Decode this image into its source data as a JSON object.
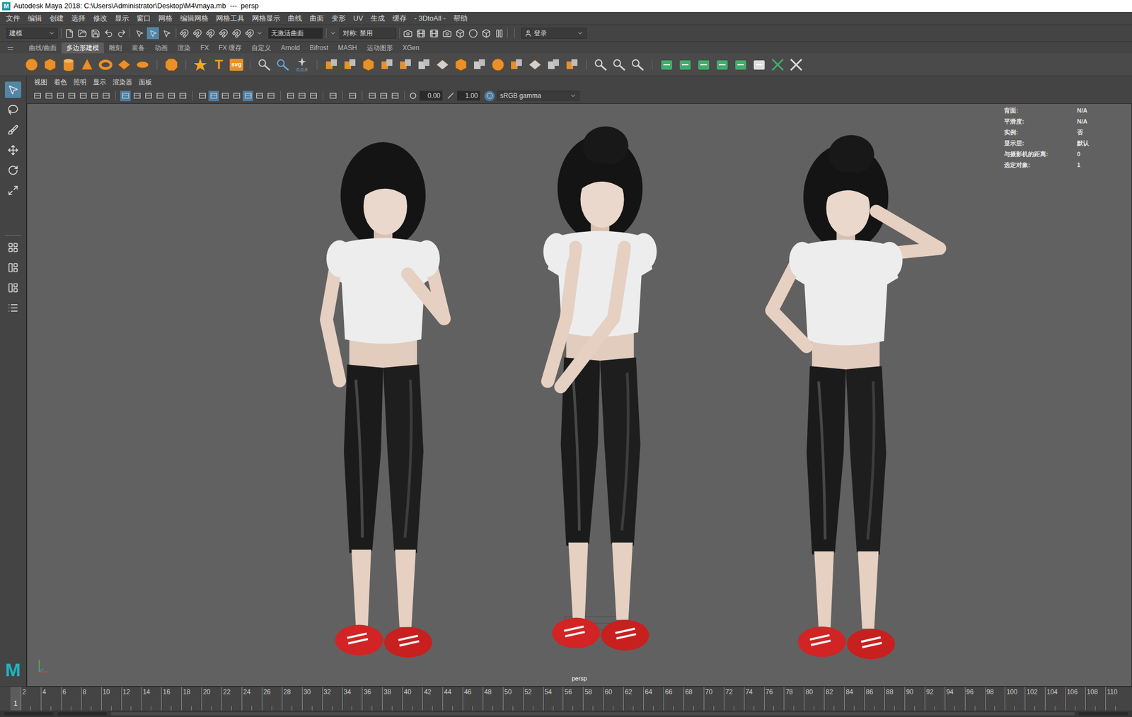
{
  "window": {
    "title": "Autodesk Maya 2018: C:\\Users\\Administrator\\Desktop\\M4\\maya.mb  ---  persp",
    "logo": "M"
  },
  "menu": [
    "文件",
    "编辑",
    "创建",
    "选择",
    "修改",
    "显示",
    "窗口",
    "网格",
    "编辑网格",
    "网格工具",
    "网格显示",
    "曲线",
    "曲面",
    "变形",
    "UV",
    "生成",
    "缓存",
    "- 3DtoAll -",
    "帮助"
  ],
  "status_line": {
    "mode": "建模",
    "surface": "无激活曲面",
    "symmetry": "对称: 禁用",
    "login": "登录",
    "toggles": [
      {
        "on": false
      },
      {
        "on": true
      },
      {
        "on": false
      }
    ]
  },
  "shelf": {
    "tabs": [
      {
        "label": "曲线/曲面",
        "selected": false
      },
      {
        "label": "多边形建模",
        "selected": true
      },
      {
        "label": "雕刻",
        "selected": false
      },
      {
        "label": "装备",
        "selected": false
      },
      {
        "label": "动画",
        "selected": false
      },
      {
        "label": "渲染",
        "selected": false
      },
      {
        "label": "FX",
        "selected": false
      },
      {
        "label": "FX 缓存",
        "selected": false
      },
      {
        "label": "自定义",
        "selected": false
      },
      {
        "label": "Arnold",
        "selected": false
      },
      {
        "label": "Bifrost",
        "selected": false
      },
      {
        "label": "MASH",
        "selected": false
      },
      {
        "label": "运动图形",
        "selected": false
      },
      {
        "label": "XGen",
        "selected": false
      }
    ],
    "icon_labels": {
      "text": "T",
      "svg": "svg",
      "origin": "0,0,0"
    }
  },
  "toolbox": {
    "tools": [
      {
        "selected": true
      },
      {
        "selected": false
      },
      {
        "selected": false
      },
      {
        "selected": false
      },
      {
        "selected": false
      },
      {
        "selected": false
      }
    ]
  },
  "panel": {
    "menu": [
      "视图",
      "着色",
      "照明",
      "显示",
      "渲染器",
      "面板"
    ],
    "toggles": [
      {
        "on": false
      },
      {
        "on": false
      },
      {
        "on": false
      },
      {
        "on": false
      },
      {
        "on": false
      },
      {
        "on": false
      },
      {
        "on": false
      },
      {
        "on": true
      },
      {
        "on": false
      },
      {
        "on": false
      },
      {
        "on": false
      },
      {
        "on": false
      },
      {
        "on": false
      },
      {
        "on": false
      },
      {
        "on": true
      },
      {
        "on": false
      },
      {
        "on": false
      },
      {
        "on": true
      },
      {
        "on": false
      },
      {
        "on": false
      },
      {
        "on": false
      },
      {
        "on": false
      },
      {
        "on": false
      },
      {
        "on": false
      },
      {
        "on": false
      },
      {
        "on": false
      },
      {
        "on": false
      },
      {
        "on": false
      }
    ],
    "exposure": "0.00",
    "gamma": "1.00",
    "color_management_on": true,
    "color_space": "sRGB gamma"
  },
  "hud": [
    {
      "label": "背面:",
      "value": "N/A"
    },
    {
      "label": "平滑度:",
      "value": "N/A"
    },
    {
      "label": "实例:",
      "value": "否"
    },
    {
      "label": "显示层:",
      "value": "默认"
    },
    {
      "label": "与摄影机的距离:",
      "value": "0"
    },
    {
      "label": "选定对象:",
      "value": "1"
    }
  ],
  "camera": "persp",
  "timeline": {
    "current": "1",
    "ticks": [
      "2",
      "4",
      "6",
      "8",
      "10",
      "12",
      "14",
      "16",
      "18",
      "20",
      "22",
      "24",
      "26",
      "28",
      "30",
      "32",
      "34",
      "36",
      "38",
      "40",
      "42",
      "44",
      "46",
      "48",
      "50",
      "52",
      "54",
      "56",
      "58",
      "60",
      "62",
      "64",
      "66",
      "68",
      "70",
      "72",
      "74",
      "76",
      "78",
      "80",
      "82",
      "84",
      "86",
      "88",
      "90",
      "92",
      "94",
      "96",
      "98",
      "100",
      "102",
      "104",
      "106",
      "108",
      "110"
    ]
  }
}
